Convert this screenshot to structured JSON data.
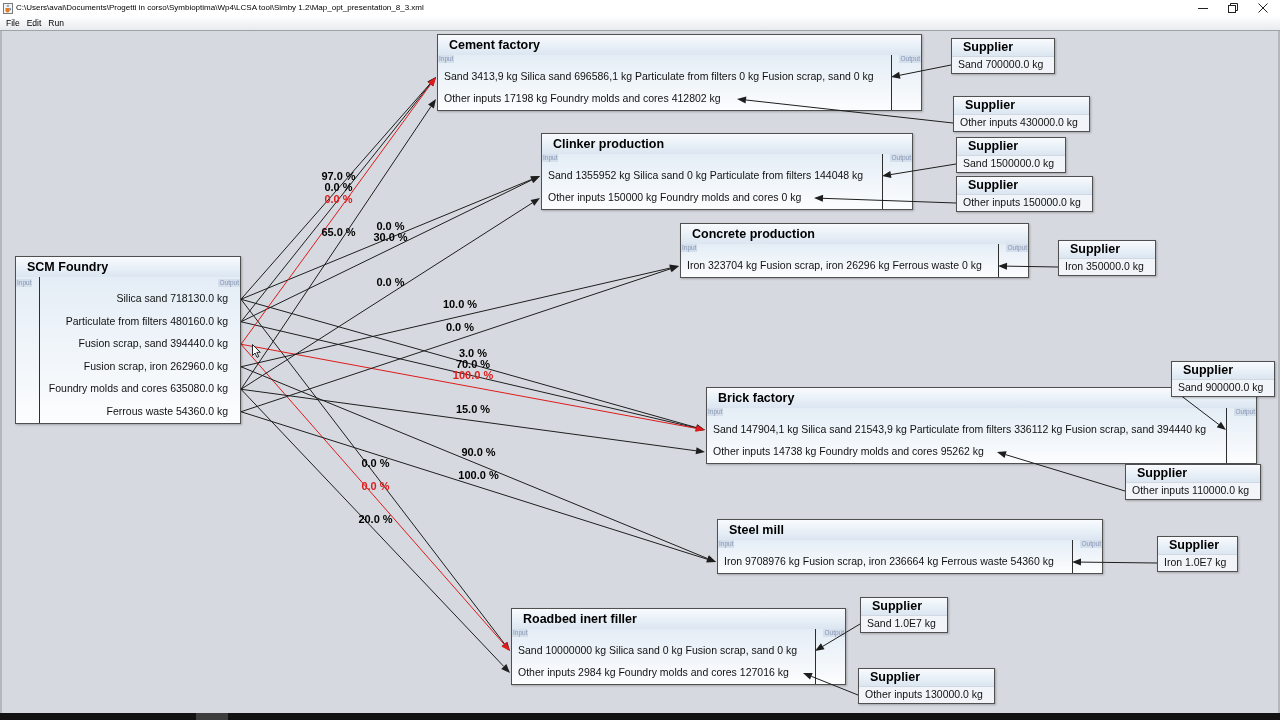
{
  "window": {
    "title": "C:\\Users\\avai\\Documents\\Progetti in corso\\Symbioptima\\Wp4\\LCSA tool\\Simby 1.2\\Map_opt_presentation_8_3.xml"
  },
  "menu": [
    "File",
    "Edit",
    "Run"
  ],
  "source": {
    "title": "SCM Foundry",
    "input_label": "Input",
    "output_label": "Output",
    "outputs": [
      {
        "text": "Silica sand 718130.0 kg",
        "selected": false,
        "flow_labels": [
          "97.0 %",
          "0.0 %",
          "3.0 %",
          "0.0 %"
        ]
      },
      {
        "text": "Particulate from filters 480160.0 kg",
        "selected": false,
        "flow_labels": [
          "0.0 %",
          "30.0 %",
          "70.0 %"
        ]
      },
      {
        "text": "Fusion scrap, sand 394440.0 kg",
        "selected": true,
        "flow_labels": [
          "0.0 %",
          "100.0 %",
          "0.0 %"
        ]
      },
      {
        "text": "Fusion scrap, iron 262960.0 kg",
        "selected": false,
        "flow_labels": [
          "10.0 %",
          "90.0 %"
        ]
      },
      {
        "text": "Foundry molds and cores 635080.0 kg",
        "selected": false,
        "flow_labels": [
          "65.0 %",
          "0.0 %",
          "15.0 %",
          "20.0 %"
        ]
      },
      {
        "text": "Ferrous waste 54360.0 kg",
        "selected": false,
        "flow_labels": [
          "0.0 %",
          "100.0 %"
        ]
      }
    ]
  },
  "processes": [
    {
      "title": "Cement factory",
      "input_label": "Input",
      "output_label": "Output",
      "rows": [
        "Sand 3413,9 kg Silica sand 696586,1 kg Particulate from filters 0 kg Fusion scrap, sand 0 kg",
        "Other inputs 17198 kg Foundry molds and cores 412802 kg"
      ]
    },
    {
      "title": "Clinker production",
      "input_label": "Input",
      "output_label": "Output",
      "rows": [
        "Sand 1355952 kg Silica sand 0 kg Particulate from filters 144048 kg",
        "Other inputs 150000 kg Foundry molds and cores 0 kg"
      ]
    },
    {
      "title": "Concrete production",
      "input_label": "Input",
      "output_label": "Output",
      "rows": [
        "Iron 323704 kg Fusion scrap, iron 26296 kg Ferrous waste 0 kg"
      ]
    },
    {
      "title": "Brick factory",
      "input_label": "Input",
      "output_label": "Output",
      "rows": [
        "Sand 147904,1 kg Silica sand 21543,9 kg Particulate from filters 336112 kg Fusion scrap, sand 394440 kg",
        "Other inputs 14738 kg Foundry molds and cores 95262 kg"
      ]
    },
    {
      "title": "Steel mill",
      "input_label": "Input",
      "output_label": "Output",
      "rows": [
        "Iron 9708976 kg Fusion scrap, iron 236664 kg Ferrous waste 54360 kg"
      ]
    },
    {
      "title": "Roadbed inert filler",
      "input_label": "Input",
      "output_label": "Output",
      "rows": [
        "Sand 10000000 kg Silica sand 0 kg Fusion scrap, sand 0 kg",
        "Other inputs 2984 kg Foundry molds and cores 127016 kg"
      ]
    }
  ],
  "suppliers": [
    {
      "title": "Supplier",
      "text": "Sand 700000.0 kg"
    },
    {
      "title": "Supplier",
      "text": "Other inputs 430000.0 kg"
    },
    {
      "title": "Supplier",
      "text": "Sand 1500000.0 kg"
    },
    {
      "title": "Supplier",
      "text": "Other inputs 150000.0 kg"
    },
    {
      "title": "Supplier",
      "text": "Iron 350000.0 kg"
    },
    {
      "title": "Supplier",
      "text": "Sand 900000.0 kg"
    },
    {
      "title": "Supplier",
      "text": "Other inputs 110000.0 kg"
    },
    {
      "title": "Supplier",
      "text": "Iron 1.0E7 kg"
    },
    {
      "title": "Supplier",
      "text": "Sand 1.0E7 kg"
    },
    {
      "title": "Supplier",
      "text": "Other inputs 130000.0 kg"
    }
  ]
}
